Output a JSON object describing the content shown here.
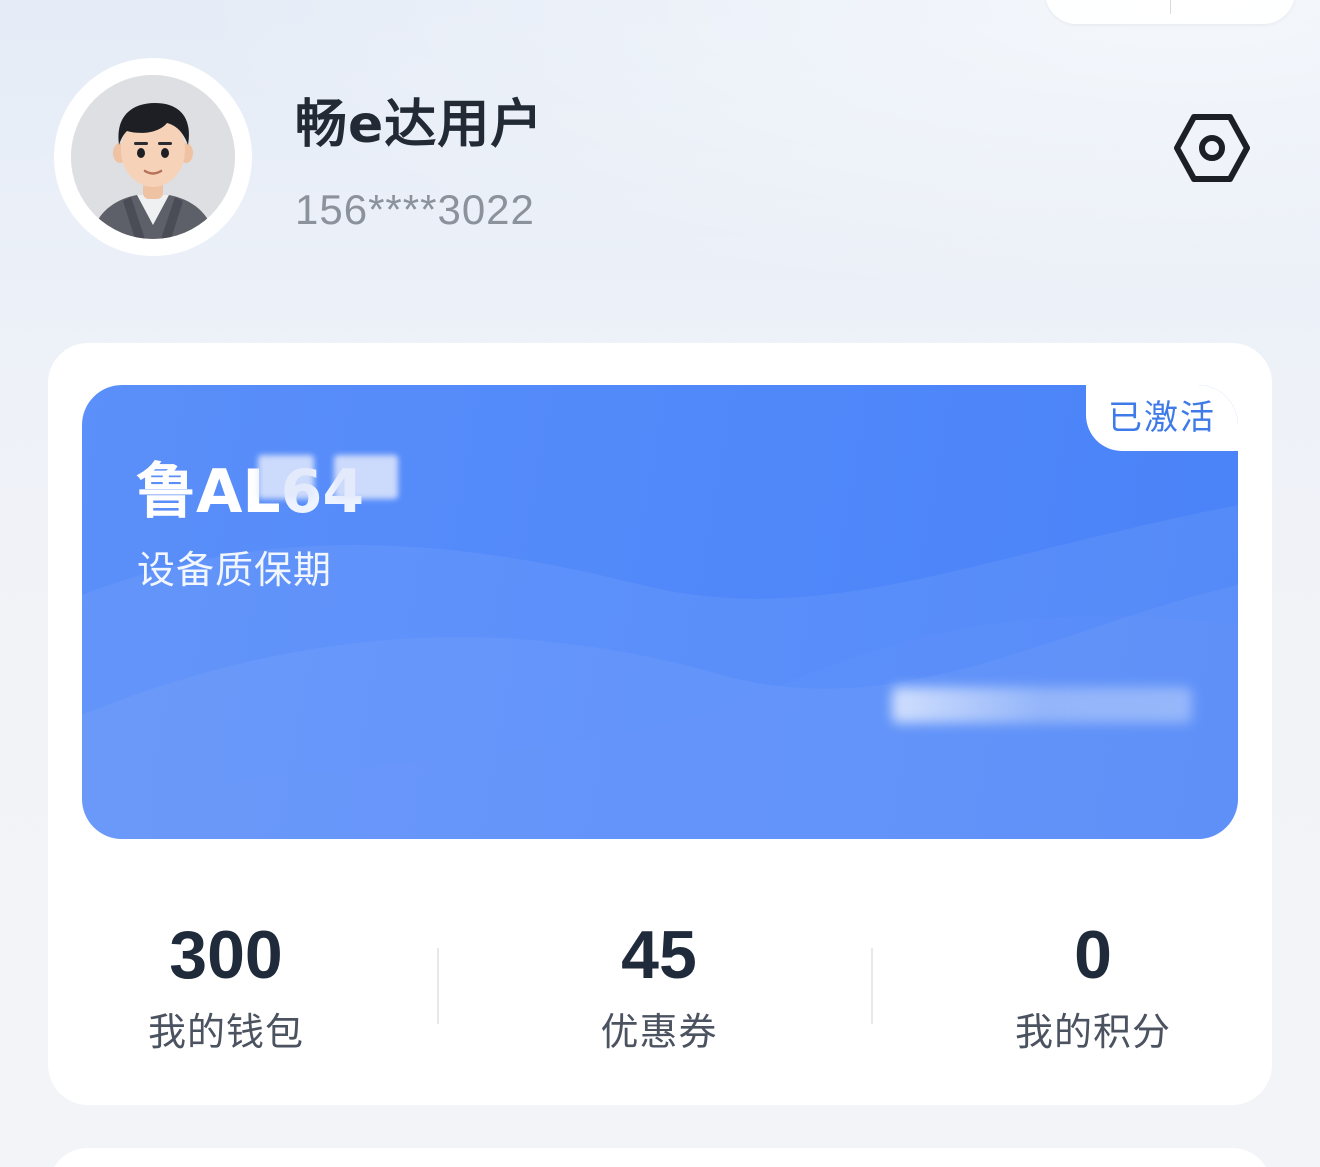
{
  "profile": {
    "name": "畅e达用户",
    "phone": "156****3022"
  },
  "device_card": {
    "plate": "鲁AL",
    "plate_masked_suffix": "64",
    "status_badge": "已激活",
    "subtitle": "设备质保期",
    "colors": {
      "card_start": "#5b8ff9",
      "card_end": "#4a83f8",
      "badge_text": "#3f7be8"
    }
  },
  "stats": [
    {
      "value": "300",
      "label": "我的钱包"
    },
    {
      "value": "45",
      "label": "优惠券"
    },
    {
      "value": "0",
      "label": "我的积分"
    }
  ],
  "icons": {
    "settings": "hexagon-settings-icon",
    "avatar": "cartoon-man-avatar"
  }
}
